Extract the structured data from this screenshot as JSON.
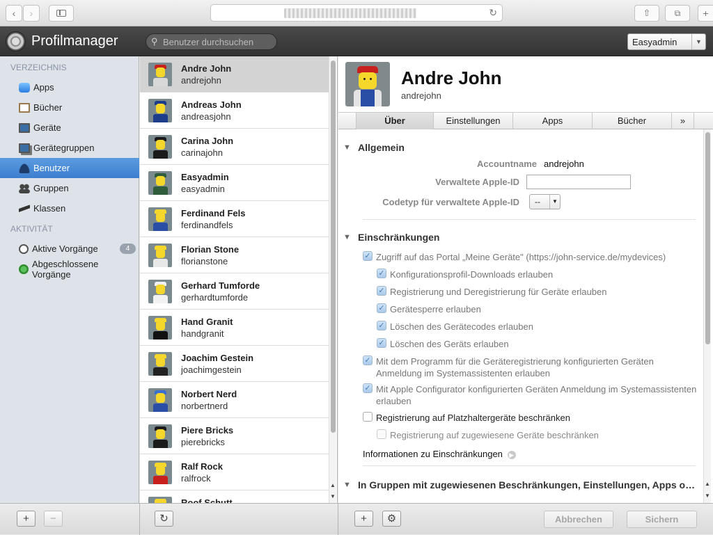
{
  "browser": {
    "url": "",
    "back_icon": "chevron-left",
    "forward_icon": "chevron-right",
    "sidebar_icon": "sidebar",
    "share_icon": "share",
    "tabs_icon": "tabs",
    "newtab_label": "+",
    "reload_icon": "reload"
  },
  "app": {
    "title": "Profilmanager",
    "search_placeholder": "Benutzer durchsuchen",
    "user_menu": "Easyadmin"
  },
  "sidebar": {
    "section_directory": "VERZEICHNIS",
    "section_activity": "AKTIVITÄT",
    "directory_items": [
      {
        "label": "Apps",
        "icon": "apps-icon",
        "color": "#3a8ee6"
      },
      {
        "label": "Bücher",
        "icon": "book-icon",
        "color": "#9a7a4a"
      },
      {
        "label": "Geräte",
        "icon": "monitor-icon",
        "color": "#5a6a80"
      },
      {
        "label": "Gerätegruppen",
        "icon": "device-group-icon",
        "color": "#5a6a80"
      },
      {
        "label": "Benutzer",
        "icon": "user-icon",
        "color": "#ffffff"
      },
      {
        "label": "Gruppen",
        "icon": "group-icon",
        "color": "#555555"
      },
      {
        "label": "Klassen",
        "icon": "graduation-cap-icon",
        "color": "#444444"
      }
    ],
    "activity_items": [
      {
        "label": "Aktive Vorgänge",
        "icon": "clock-icon",
        "badge": "4"
      },
      {
        "label": "Abgeschlossene Vorgänge",
        "icon": "completed-icon",
        "badge": ""
      }
    ],
    "selected_label": "Benutzer"
  },
  "users": [
    {
      "name": "Andre John",
      "login": "andrejohn",
      "hat": "#c8201c",
      "body": "#d8d8d8"
    },
    {
      "name": "Andreas John",
      "login": "andreasjohn",
      "hat": "#1d3c8a",
      "body": "#1d3c8a"
    },
    {
      "name": "Carina John",
      "login": "carinajohn",
      "hat": "#1a1a1a",
      "body": "#1a1a1a"
    },
    {
      "name": "Easyadmin",
      "login": "easyadmin",
      "hat": "#2f5c3a",
      "body": "#2f5c3a"
    },
    {
      "name": "Ferdinand Fels",
      "login": "ferdinandfels",
      "hat": "#f5d62a",
      "body": "#2a4ea5"
    },
    {
      "name": "Florian Stone",
      "login": "florianstone",
      "hat": "#f5d62a",
      "body": "#e8e8e8"
    },
    {
      "name": "Gerhard Tumforde",
      "login": "gerhardtumforde",
      "hat": "#f2f2f2",
      "body": "#f2f2f2"
    },
    {
      "name": "Hand Granit",
      "login": "handgranit",
      "hat": "#f5d62a",
      "body": "#111111"
    },
    {
      "name": "Joachim Gestein",
      "login": "joachimgestein",
      "hat": "#f5d62a",
      "body": "#222222"
    },
    {
      "name": "Norbert Nerd",
      "login": "norbertnerd",
      "hat": "#3a6fd0",
      "body": "#2a4ea5"
    },
    {
      "name": "Piere Bricks",
      "login": "pierebricks",
      "hat": "#1a1a1a",
      "body": "#1a1a1a"
    },
    {
      "name": "Ralf Rock",
      "login": "ralfrock",
      "hat": "#f5d62a",
      "body": "#c8201c"
    },
    {
      "name": "Roof Schutt",
      "login": "",
      "hat": "#f5d62a",
      "body": "#555555"
    }
  ],
  "detail": {
    "name": "Andre John",
    "login": "andrejohn",
    "tabs": [
      "Über",
      "Einstellungen",
      "Apps",
      "Bücher",
      "»"
    ],
    "active_tab": "Über",
    "general": {
      "title": "Allgemein",
      "account_label": "Accountname",
      "account_value": "andrejohn",
      "apple_id_label": "Verwaltete Apple-ID",
      "apple_id_value": "",
      "codetype_label": "Codetyp für verwaltete Apple-ID",
      "codetype_value": "--"
    },
    "restrictions": {
      "title": "Einschränkungen",
      "items": [
        {
          "label": "Zugriff auf das Portal „Meine Geräte\" (https://john-service.de/mydevices)",
          "checked": true
        },
        {
          "label": "Konfigurationsprofil-Downloads erlauben",
          "checked": true
        },
        {
          "label": "Registrierung und Deregistrierung für Geräte erlauben",
          "checked": true
        },
        {
          "label": "Gerätesperre erlauben",
          "checked": true
        },
        {
          "label": "Löschen des Gerätecodes erlauben",
          "checked": true
        },
        {
          "label": "Löschen des Geräts erlauben",
          "checked": true
        },
        {
          "label": "Mit dem Programm für die Geräteregistrierung konfigurierten Geräten Anmeldung im Systemassistenten erlauben",
          "checked": true
        },
        {
          "label": "Mit Apple Configurator konfigurierten Geräten Anmeldung im Systemassistenten erlauben",
          "checked": true
        },
        {
          "label": "Registrierung auf Platzhaltergeräte beschränken",
          "checked": false
        },
        {
          "label": "Registrierung auf zugewiesene Geräte beschränken",
          "checked": false
        }
      ],
      "info_link": "Informationen zu Einschränkungen"
    },
    "groups_section": "In Gruppen mit zugewiesenen Beschränkungen, Einstellungen, Apps o…"
  },
  "footer": {
    "add": "+",
    "remove": "−",
    "refresh_icon": "refresh",
    "gear_icon": "gear",
    "cancel": "Abbrechen",
    "save": "Sichern"
  }
}
